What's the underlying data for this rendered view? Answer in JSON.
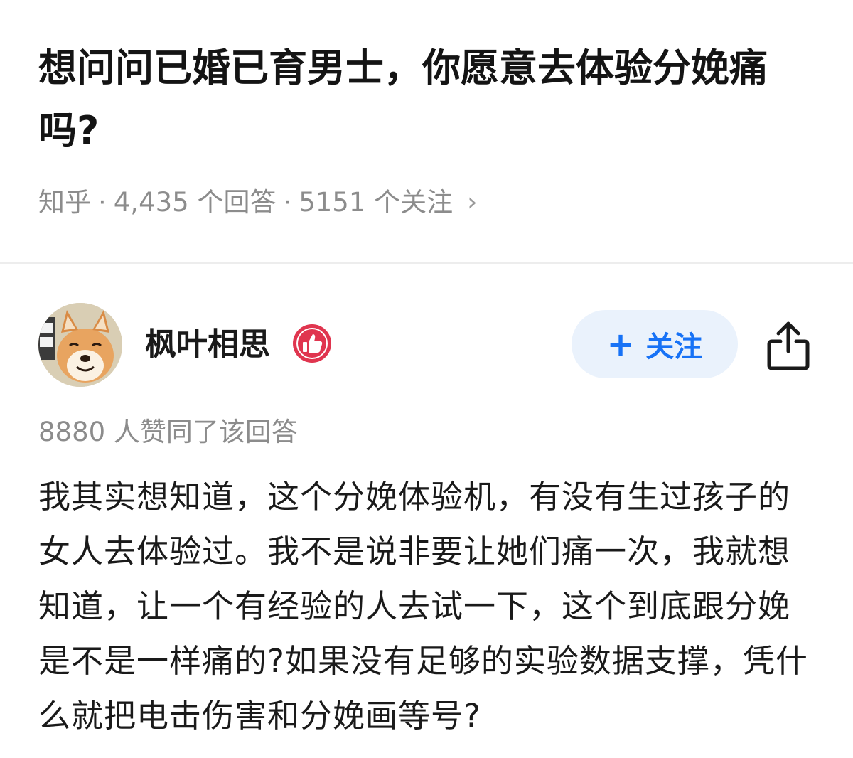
{
  "question": {
    "title": "想问问已婚已育男士，你愿意去体验分娩痛吗?",
    "source": "知乎",
    "separator": "·",
    "answers": "4,435 个回答",
    "followers": "5151 个关注",
    "chevron": "›"
  },
  "answer": {
    "author": {
      "name": "枫叶相思",
      "avatar_icon": "shiba-dog-avatar",
      "badge_icon": "thumbs-up-badge-icon"
    },
    "follow_button": {
      "plus": "+",
      "label": "关注",
      "color": "#1772f6",
      "bg": "#eaf2fc"
    },
    "share_icon": "share-upload-icon",
    "vote_text": "8880 人赞同了该回答",
    "content": "我其实想知道，这个分娩体验机，有没有生过孩子的女人去体验过。我不是说非要让她们痛一次，我就想知道，让一个有经验的人去试一下，这个到底跟分娩是不是一样痛的?如果没有足够的实验数据支撑，凭什么就把电击伤害和分娩画等号?"
  },
  "colors": {
    "meta_gray": "#8c8c8c",
    "accent_blue": "#1772f6",
    "badge_red": "#e0354f"
  }
}
